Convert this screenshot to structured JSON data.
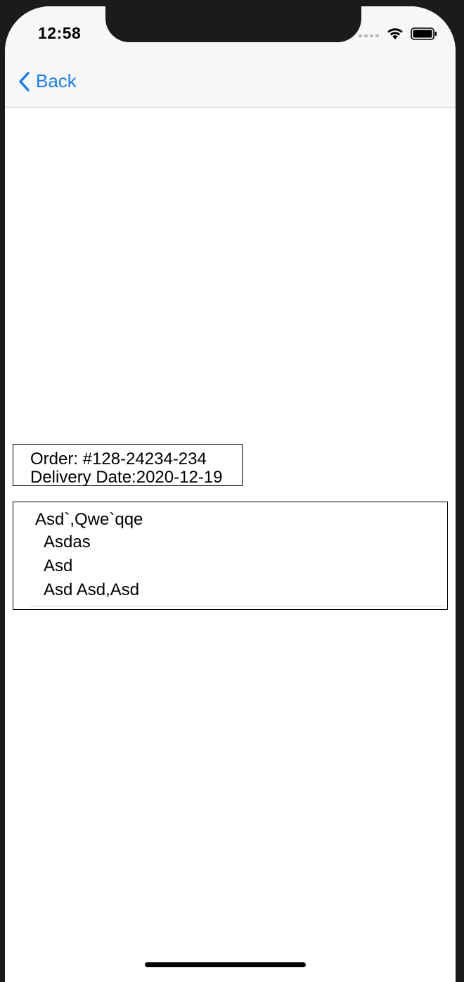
{
  "status_bar": {
    "time": "12:58",
    "icons": [
      "cellular-signal-icon",
      "wifi-icon",
      "battery-icon"
    ]
  },
  "nav": {
    "back_label": "Back",
    "back_icon": "chevron-left-icon",
    "accent_color": "#147EFB"
  },
  "order": {
    "number_line": "Order: #128-24234-234",
    "delivery_line": "Delivery Date:2020-12-19"
  },
  "items": {
    "header": "Asd`,Qwe`qqe",
    "lines": [
      "Asdas",
      "Asd",
      "Asd Asd,Asd"
    ]
  }
}
